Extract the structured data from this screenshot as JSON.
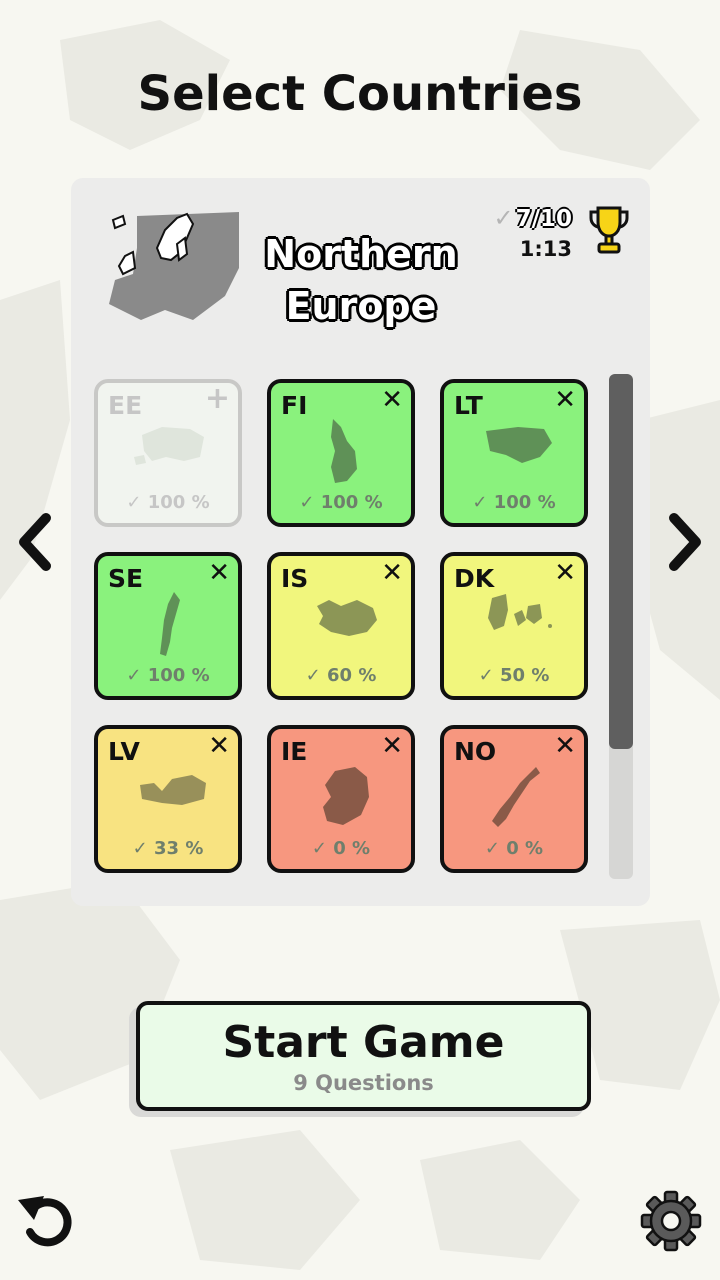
{
  "page": {
    "title": "Select Countries"
  },
  "region": {
    "name_line1": "Northern",
    "name_line2": "Europe",
    "best_score": "7/10",
    "best_time": "1:13"
  },
  "countries": [
    {
      "code": "EE",
      "percent": "100 %",
      "status": "unselected",
      "action": "+"
    },
    {
      "code": "FI",
      "percent": "100 %",
      "status": "selected",
      "action": "✕"
    },
    {
      "code": "LT",
      "percent": "100 %",
      "status": "selected",
      "action": "✕"
    },
    {
      "code": "SE",
      "percent": "100 %",
      "status": "selected",
      "action": "✕"
    },
    {
      "code": "IS",
      "percent": "60 %",
      "status": "selected",
      "action": "✕"
    },
    {
      "code": "DK",
      "percent": "50 %",
      "status": "selected",
      "action": "✕"
    },
    {
      "code": "LV",
      "percent": "33 %",
      "status": "selected",
      "action": "✕"
    },
    {
      "code": "IE",
      "percent": "0 %",
      "status": "selected",
      "action": "✕"
    },
    {
      "code": "NO",
      "percent": "0 %",
      "status": "selected",
      "action": "✕"
    }
  ],
  "start_button": {
    "label": "Start Game",
    "subtitle": "9 Questions"
  },
  "colors": {
    "green": "#8af27d",
    "yellow": "#f1f67d",
    "gold": "#f8e381",
    "red": "#f7977f",
    "trophy": "#f7d417"
  },
  "icons": {
    "prev": "chevron-left-icon",
    "next": "chevron-right-icon",
    "undo": "undo-icon",
    "settings": "gear-icon",
    "trophy": "trophy-icon",
    "check": "check-icon"
  }
}
